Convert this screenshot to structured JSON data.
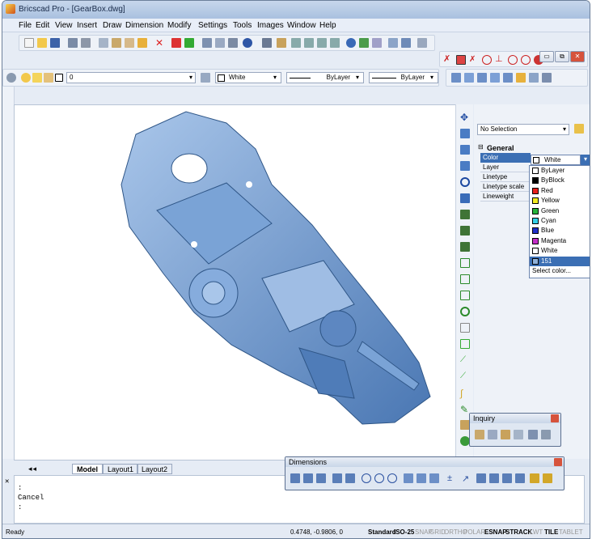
{
  "window": {
    "title": "Bricscad Pro - [GearBox.dwg]"
  },
  "menu": [
    "File",
    "Edit",
    "View",
    "Insert",
    "Draw",
    "Dimension",
    "Modify",
    "Settings",
    "Tools",
    "Images",
    "Window",
    "Help"
  ],
  "layer_bar": {
    "layer": "0",
    "color": "White",
    "linetype1": "ByLayer",
    "linetype2": "ByLayer"
  },
  "props": {
    "selection": "No Selection",
    "section": "General",
    "rows": [
      "Color",
      "Layer",
      "Linetype",
      "Linetype scale",
      "Lineweight"
    ],
    "color_value": "White",
    "dropdown": [
      "ByLayer",
      "ByBlock",
      "Red",
      "Yellow",
      "Green",
      "Cyan",
      "Blue",
      "Magenta",
      "White",
      "151",
      "Select color..."
    ],
    "dropdown_colors": [
      "#ffffff",
      "#000000",
      "#e8201c",
      "#f3ec22",
      "#25b33a",
      "#34d0e6",
      "#2030c9",
      "#c52ec8",
      "#ffffff",
      "#8fb1d9",
      ""
    ]
  },
  "tabs": [
    "Model",
    "Layout1",
    "Layout2"
  ],
  "cmd": {
    "line1": ":",
    "line2": "Cancel",
    "line3": ":"
  },
  "status": {
    "ready": "Ready",
    "coords": "0.4748, -0.9806, 0",
    "standard": "Standard",
    "iso": "ISO-25",
    "toggles": [
      "SNAP",
      "GRID",
      "ORTHO",
      "POLAR",
      "ESNAP",
      "STRACK",
      "LWT",
      "TILE",
      "TABLET"
    ]
  },
  "inquiry": {
    "title": "Inquiry"
  },
  "dimensions": {
    "title": "Dimensions"
  },
  "colors": {
    "accent": "#3b6fb4",
    "model": "#7aa3d6"
  }
}
